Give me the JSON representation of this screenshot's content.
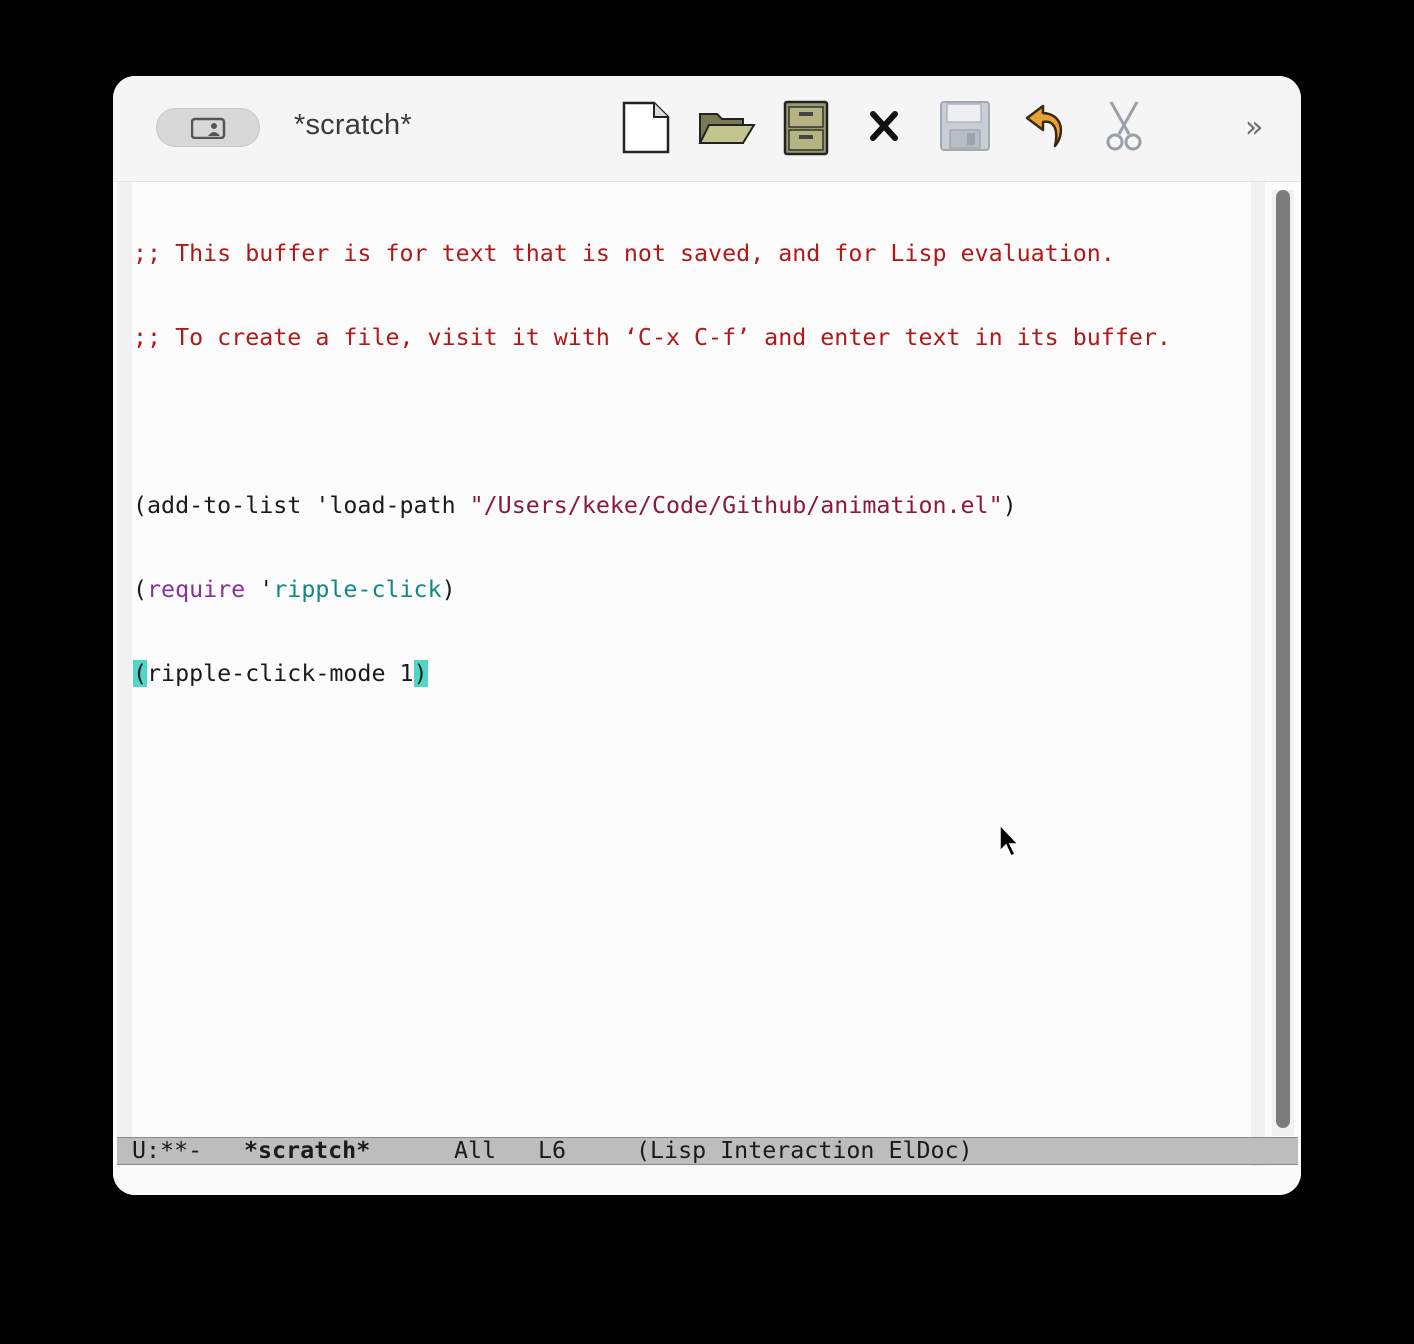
{
  "window": {
    "title": "*scratch*"
  },
  "toolbar": {
    "icons": [
      "new-file-icon",
      "open-folder-icon",
      "file-cabinet-icon",
      "close-icon",
      "save-disk-icon",
      "undo-icon",
      "scissors-icon"
    ],
    "overflow": "»"
  },
  "buffer": {
    "comment1": ";; This buffer is for text that is not saved, and for Lisp evaluation.",
    "comment2": ";; To create a file, visit it with ‘C-x C-f’ and enter text in its buffer.",
    "line4": {
      "open": "(add-to-list 'load-path ",
      "string": "\"/Users/keke/Code/Github/animation.el\"",
      "close": ")"
    },
    "line5": {
      "open": "(",
      "keyword": "require",
      "quote": " '",
      "constant": "ripple-click",
      "close": ")"
    },
    "line6": {
      "open_paren": "(",
      "body": "ripple-click-mode 1",
      "close_paren": ")"
    }
  },
  "modeline": {
    "status": "U:**-",
    "buffer_name": "*scratch*",
    "position": "All",
    "line": "L6",
    "modes": "(Lisp Interaction ElDoc)"
  },
  "colors": {
    "comment": "#b21818",
    "string": "#8b1a3a",
    "keyword": "#8a2fa0",
    "constant": "#118888",
    "paren_match": "#4fd6c8"
  }
}
